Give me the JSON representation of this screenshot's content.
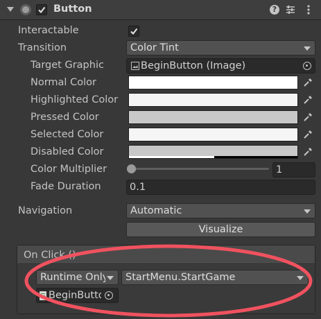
{
  "component": {
    "title": "Button",
    "enabled": true
  },
  "properties": {
    "interactable": {
      "label": "Interactable",
      "checked": true
    },
    "transition": {
      "label": "Transition",
      "value": "Color Tint"
    },
    "target_graphic": {
      "label": "Target Graphic",
      "value": "BeginButton (Image)"
    },
    "normal_color": {
      "label": "Normal Color",
      "color": "#ffffff"
    },
    "highlighted_color": {
      "label": "Highlighted Color",
      "color": "#f5f5f5"
    },
    "pressed_color": {
      "label": "Pressed Color",
      "color": "#c8c8c8"
    },
    "selected_color": {
      "label": "Selected Color",
      "color": "#f5f5f5"
    },
    "disabled_color": {
      "label": "Disabled Color",
      "color": "#c8c8c8",
      "alpha": 0.5
    },
    "color_multiplier": {
      "label": "Color Multiplier",
      "value": "1",
      "slider_fraction": 0.0
    },
    "fade_duration": {
      "label": "Fade Duration",
      "value": "0.1"
    },
    "navigation": {
      "label": "Navigation",
      "value": "Automatic"
    },
    "visualize_label": "Visualize"
  },
  "on_click": {
    "header": "On Click ()",
    "runtime": "Runtime Only",
    "function": "StartMenu.StartGame",
    "target": "BeginButto"
  },
  "icons": {
    "foldout": "foldout-arrow-icon",
    "component": "button-component-icon",
    "help": "help-icon",
    "presets": "presets-icon",
    "menu": "context-menu-icon",
    "picker": "eyedropper-icon",
    "object_picker": "object-picker-icon",
    "image": "image-icon",
    "script": "script-icon"
  },
  "annotation": {
    "color": "#f0525f"
  }
}
